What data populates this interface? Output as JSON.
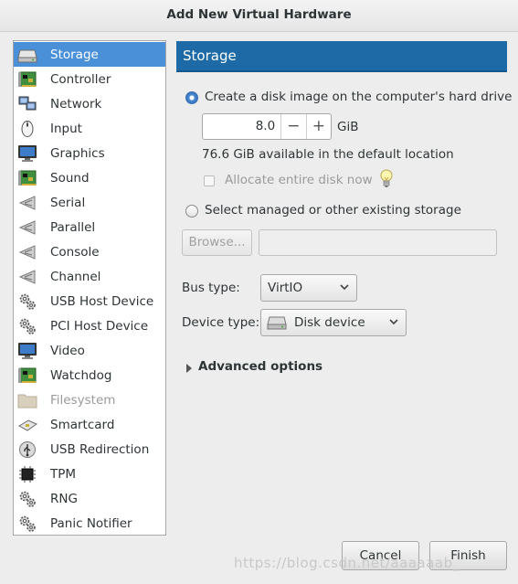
{
  "window": {
    "title": "Add New Virtual Hardware"
  },
  "sidebar": {
    "items": [
      {
        "label": "Storage",
        "icon": "hard-disk-icon",
        "selected": true,
        "disabled": false
      },
      {
        "label": "Controller",
        "icon": "controller-card-icon",
        "selected": false,
        "disabled": false
      },
      {
        "label": "Network",
        "icon": "network-icon",
        "selected": false,
        "disabled": false
      },
      {
        "label": "Input",
        "icon": "mouse-icon",
        "selected": false,
        "disabled": false
      },
      {
        "label": "Graphics",
        "icon": "monitor-icon",
        "selected": false,
        "disabled": false
      },
      {
        "label": "Sound",
        "icon": "sound-card-icon",
        "selected": false,
        "disabled": false
      },
      {
        "label": "Serial",
        "icon": "serial-port-icon",
        "selected": false,
        "disabled": false
      },
      {
        "label": "Parallel",
        "icon": "parallel-port-icon",
        "selected": false,
        "disabled": false
      },
      {
        "label": "Console",
        "icon": "console-port-icon",
        "selected": false,
        "disabled": false
      },
      {
        "label": "Channel",
        "icon": "channel-port-icon",
        "selected": false,
        "disabled": false
      },
      {
        "label": "USB Host Device",
        "icon": "gear-icon",
        "selected": false,
        "disabled": false
      },
      {
        "label": "PCI Host Device",
        "icon": "gear-icon",
        "selected": false,
        "disabled": false
      },
      {
        "label": "Video",
        "icon": "monitor-icon",
        "selected": false,
        "disabled": false
      },
      {
        "label": "Watchdog",
        "icon": "watchdog-card-icon",
        "selected": false,
        "disabled": false
      },
      {
        "label": "Filesystem",
        "icon": "folder-icon",
        "selected": false,
        "disabled": true
      },
      {
        "label": "Smartcard",
        "icon": "smartcard-icon",
        "selected": false,
        "disabled": false
      },
      {
        "label": "USB Redirection",
        "icon": "usb-icon",
        "selected": false,
        "disabled": false
      },
      {
        "label": "TPM",
        "icon": "chip-icon",
        "selected": false,
        "disabled": false
      },
      {
        "label": "RNG",
        "icon": "gear-icon",
        "selected": false,
        "disabled": false
      },
      {
        "label": "Panic Notifier",
        "icon": "gear-icon",
        "selected": false,
        "disabled": false
      }
    ]
  },
  "main": {
    "header": "Storage",
    "create_option": {
      "label": "Create a disk image on the computer's hard drive",
      "selected": true
    },
    "size": {
      "value": "8.0",
      "unit": "GiB",
      "decrement": "−",
      "increment": "+"
    },
    "available_text": "76.6 GiB available in the default location",
    "allocate_checkbox": {
      "label": "Allocate entire disk now",
      "checked": false,
      "enabled": false
    },
    "existing_option": {
      "label": "Select managed or other existing storage",
      "selected": false
    },
    "browse_button": "Browse...",
    "path_value": "",
    "bus_type": {
      "label": "Bus type:",
      "value": "VirtIO"
    },
    "device_type": {
      "label": "Device type:",
      "value": "Disk device"
    },
    "advanced": {
      "label": "Advanced options",
      "expanded": false
    }
  },
  "footer": {
    "cancel": "Cancel",
    "finish": "Finish"
  },
  "watermark": "https://blog.csdn.net/aaaaaab_"
}
